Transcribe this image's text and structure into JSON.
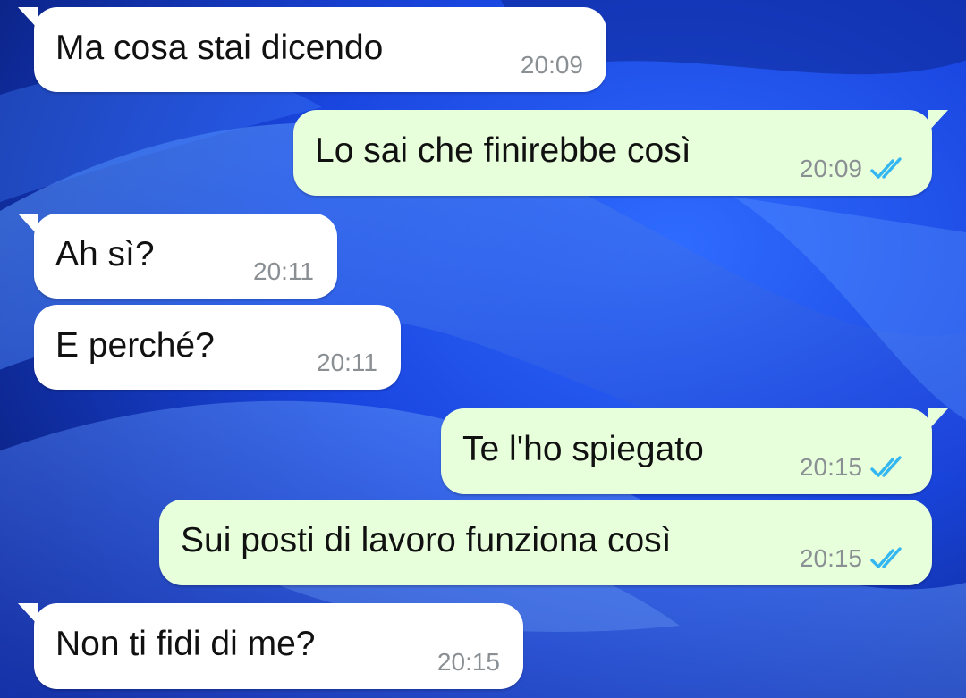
{
  "theme": {
    "incoming_bubble": "#ffffff",
    "outgoing_bubble": "#e7ffdb",
    "timestamp_color": "#8a8f93",
    "read_ticks_color": "#34b7f1",
    "wallpaper_primary": "#1e5cff"
  },
  "messages": [
    {
      "direction": "incoming",
      "text": "Ma cosa stai dicendo",
      "time": "20:09"
    },
    {
      "direction": "outgoing",
      "text": "Lo sai che finirebbe così",
      "time": "20:09",
      "status_icon": "double-check-read-icon"
    },
    {
      "direction": "incoming",
      "text": "Ah sì?",
      "time": "20:11"
    },
    {
      "direction": "incoming",
      "text": "E perché?",
      "time": "20:11"
    },
    {
      "direction": "outgoing",
      "text": "Te l'ho spiegato",
      "time": "20:15",
      "status_icon": "double-check-read-icon"
    },
    {
      "direction": "outgoing",
      "text": "Sui posti di lavoro funziona così",
      "time": "20:15",
      "status_icon": "double-check-read-icon"
    },
    {
      "direction": "incoming",
      "text": "Non ti fidi di me?",
      "time": "20:15"
    }
  ]
}
